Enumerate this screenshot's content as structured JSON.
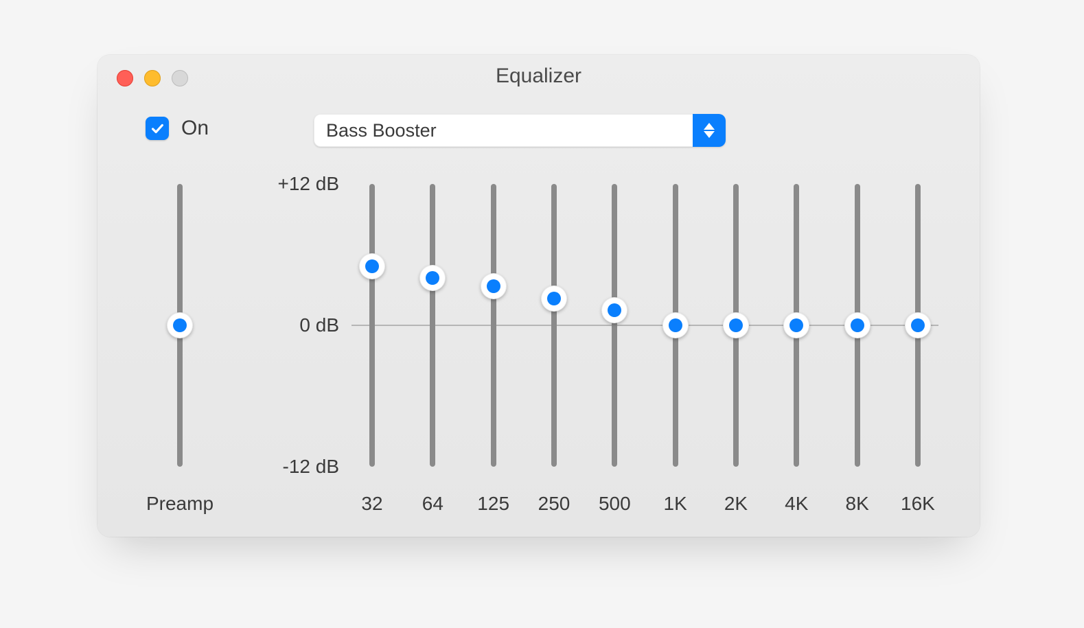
{
  "window": {
    "title": "Equalizer"
  },
  "toggle": {
    "on_label": "On",
    "checked": true
  },
  "preset": {
    "selected": "Bass Booster"
  },
  "scale": {
    "max_db": 12,
    "min_db": -12,
    "labels": {
      "top": "+12 dB",
      "mid": "0 dB",
      "bottom": "-12 dB"
    }
  },
  "preamp": {
    "label": "Preamp",
    "value_db": 0
  },
  "bands": [
    {
      "label": "32",
      "hz": 32,
      "value_db": 5.0
    },
    {
      "label": "64",
      "hz": 64,
      "value_db": 4.0
    },
    {
      "label": "125",
      "hz": 125,
      "value_db": 3.3
    },
    {
      "label": "250",
      "hz": 250,
      "value_db": 2.3
    },
    {
      "label": "500",
      "hz": 500,
      "value_db": 1.3
    },
    {
      "label": "1K",
      "hz": 1000,
      "value_db": 0
    },
    {
      "label": "2K",
      "hz": 2000,
      "value_db": 0
    },
    {
      "label": "4K",
      "hz": 4000,
      "value_db": 0
    },
    {
      "label": "8K",
      "hz": 8000,
      "value_db": 0
    },
    {
      "label": "16K",
      "hz": 16000,
      "value_db": 0
    }
  ]
}
